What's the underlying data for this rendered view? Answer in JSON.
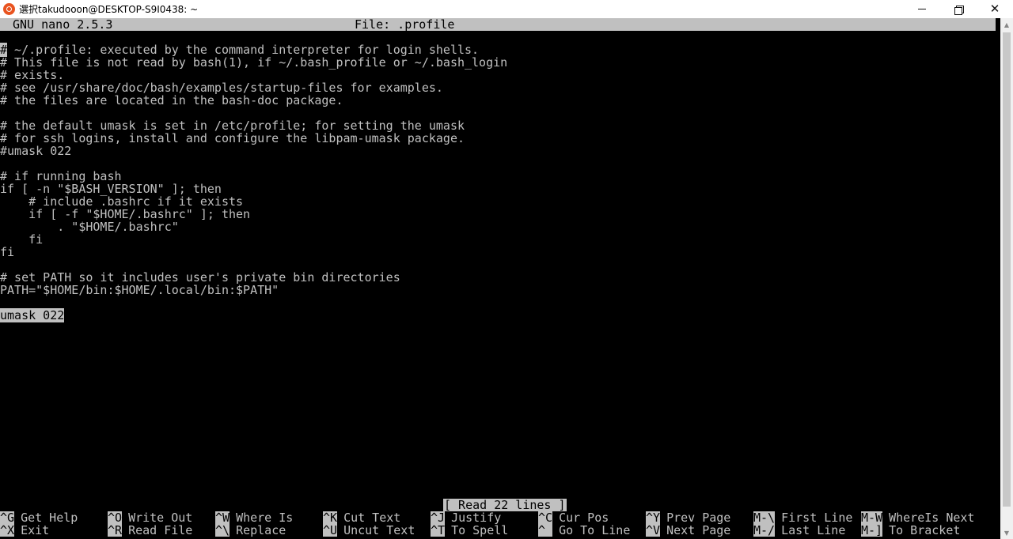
{
  "window": {
    "title": "選択takudooon@DESKTOP-S9I0438: ~",
    "icon": "ubuntu-icon",
    "controls": {
      "minimize": "—",
      "restore": "❐",
      "close": "✕"
    }
  },
  "nano": {
    "version": "GNU nano 2.5.3",
    "file": "File: .profile",
    "lines": [
      "# ~/.profile: executed by the command interpreter for login shells.",
      "# This file is not read by bash(1), if ~/.bash_profile or ~/.bash_login",
      "# exists.",
      "# see /usr/share/doc/bash/examples/startup-files for examples.",
      "# the files are located in the bash-doc package.",
      "",
      "# the default umask is set in /etc/profile; for setting the umask",
      "# for ssh logins, install and configure the libpam-umask package.",
      "#umask 022",
      "",
      "# if running bash",
      "if [ -n \"$BASH_VERSION\" ]; then",
      "    # include .bashrc if it exists",
      "    if [ -f \"$HOME/.bashrc\" ]; then",
      "        . \"$HOME/.bashrc\"",
      "    fi",
      "fi",
      "",
      "# set PATH so it includes user's private bin directories",
      "PATH=\"$HOME/bin:$HOME/.local/bin:$PATH\"",
      "",
      "umask 022"
    ],
    "status": "[ Read 22 lines ]",
    "shortcuts_row1": [
      {
        "key": "^G",
        "label": "Get Help"
      },
      {
        "key": "^O",
        "label": "Write Out"
      },
      {
        "key": "^W",
        "label": "Where Is"
      },
      {
        "key": "^K",
        "label": "Cut Text"
      },
      {
        "key": "^J",
        "label": "Justify"
      },
      {
        "key": "^C",
        "label": "Cur Pos"
      },
      {
        "key": "^Y",
        "label": "Prev Page"
      },
      {
        "key": "M-\\",
        "label": "First Line"
      },
      {
        "key": "M-W",
        "label": "WhereIs Next"
      }
    ],
    "shortcuts_row2": [
      {
        "key": "^X",
        "label": "Exit"
      },
      {
        "key": "^R",
        "label": "Read File"
      },
      {
        "key": "^\\",
        "label": "Replace"
      },
      {
        "key": "^U",
        "label": "Uncut Text"
      },
      {
        "key": "^T",
        "label": "To Spell"
      },
      {
        "key": "^_",
        "label": "Go To Line"
      },
      {
        "key": "^V",
        "label": "Next Page"
      },
      {
        "key": "M-/",
        "label": "Last Line"
      },
      {
        "key": "M-]",
        "label": "To Bracket"
      }
    ]
  }
}
